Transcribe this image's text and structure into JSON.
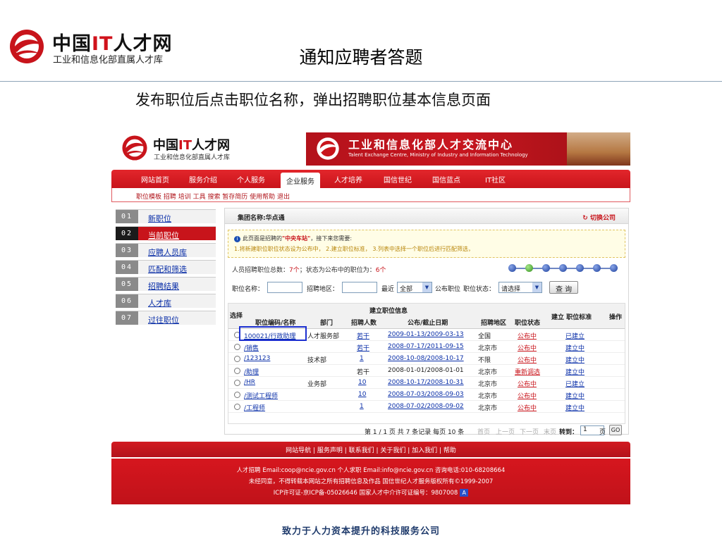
{
  "slide": {
    "brand_a": "中国",
    "brand_it": "IT",
    "brand_b": "人才网",
    "brand_sub": "工业和信息化部直属人才库",
    "title": "通知应聘者答题",
    "subtitle": "发布职位后点击职位名称，弹出招聘职位基本信息页面",
    "footer": "致力于人力资本提升的科技服务公司"
  },
  "site": {
    "brand_a": "中国",
    "brand_it": "IT",
    "brand_b": "人才网",
    "brand_sub": "工业和信息化部直属人才库",
    "banner_cn": "工业和信息化部人才交流中心",
    "banner_en": "Talent Exchange Centre,  Ministry of Industry and Information Technology"
  },
  "nav": [
    "网站首页",
    "服务介绍",
    "个人服务",
    "企业服务",
    "人才培养",
    "国信世纪",
    "国信蓝点",
    "IT社区"
  ],
  "nav_active": "企业服务",
  "subnav": "职位模板  招聘  培训  工具  搜索  暂存简历  使用帮助  退出",
  "sidebar": [
    {
      "num": "01",
      "label": "新职位"
    },
    {
      "num": "02",
      "label": "当前职位",
      "active": true
    },
    {
      "num": "03",
      "label": "应聘人员库"
    },
    {
      "num": "04",
      "label": "匹配和筛选"
    },
    {
      "num": "05",
      "label": "招聘结果"
    },
    {
      "num": "06",
      "label": "人才库"
    },
    {
      "num": "07",
      "label": "过往职位"
    }
  ],
  "panel": {
    "group": "集团名称:华点通",
    "switch": "切换公司",
    "notice_pre": "此页面是招聘的",
    "notice_site": "\"中央车站\"",
    "notice_post": "，接下来您需要:",
    "notice_line2": "1.将新建职位职位状态设为公布中， 2.建立职位标准， 3.列表中选择一个职位后进行匹配筛选，",
    "stats_a": "人员招聘职位总数：",
    "stats_total": "7个",
    "stats_b": "；状态为公布中的职位为：",
    "stats_pub": "6个"
  },
  "filter": {
    "name_label": "职位名称：",
    "region_label": "招聘地区：",
    "recent_label": "最近",
    "recent_value": "全部",
    "publish_label": "公布职位",
    "status_label": "职位状态：",
    "status_value": "请选择",
    "search_button": "查 询"
  },
  "table": {
    "headers": {
      "select": "选择",
      "group": "建立职位信息",
      "code": "职位编码/名称",
      "dept": "部门",
      "count": "招聘人数",
      "date": "公布/截止日期",
      "region": "招聘地区",
      "status": "职位状态",
      "standard": "建立 职位标准",
      "op": "操作"
    },
    "rows": [
      {
        "code": "100021/行政助理",
        "dept": "人才服务部",
        "count": "若干",
        "date": "2009-01-13/2009-03-13",
        "region": "全国",
        "status": "公布中",
        "standard": "已建立"
      },
      {
        "code": "/销售",
        "dept": "",
        "count": "若干",
        "date": "2008-07-17/2011-09-15",
        "region": "北京市",
        "status": "公布中",
        "standard": "建立中"
      },
      {
        "code": "/123123",
        "dept": "技术部",
        "count": "1",
        "date": "2008-10-08/2008-10-17",
        "region": "不限",
        "status": "公布中",
        "standard": "建立中"
      },
      {
        "code": "/助理",
        "dept": "",
        "count": "若干",
        "date": "2008-01-01/2008-01-01",
        "region": "北京市",
        "status": "重新调选",
        "standard": "建立中"
      },
      {
        "code": "/HR",
        "dept": "业务部",
        "count": "10",
        "date": "2008-10-17/2008-10-31",
        "region": "北京市",
        "status": "公布中",
        "standard": "已建立"
      },
      {
        "code": "/测试工程师",
        "dept": "",
        "count": "10",
        "date": "2008-07-03/2008-09-03",
        "region": "北京市",
        "status": "公布中",
        "standard": "建立中"
      },
      {
        "code": "/工程师",
        "dept": "",
        "count": "1",
        "date": "2008-07-02/2008-09-02",
        "region": "北京市",
        "status": "公布中",
        "standard": "建立中"
      }
    ]
  },
  "pager": {
    "summary": "第 1 / 1 页 共 7 条记录 每页 10 条",
    "first": "首页",
    "prev": "上一页",
    "next": "下一页",
    "last": "末页",
    "goto_label": "转到：",
    "goto_value": "1",
    "page_unit": "页",
    "go": "GO"
  },
  "footer": {
    "links": "网站导航 | 服务声明 | 联系我们 | 关于我们 | 加入我们 | 帮助",
    "line1": "人才招聘 Email:coop@ncie.gov.cn    个人求职 Email:info@ncie.gov.cn    咨询电话:010-68208664",
    "line2": "未经同意，不得转载本网站之所有招聘信息及作品 国信世纪人才服务版权所有©1999-2007",
    "line3": "ICP许可证-京ICP备-05026646 国家人才中介许可证编号：9807008"
  },
  "colors": {
    "brand_red": "#c8141b",
    "link_blue": "#0a2fa8",
    "highlight": "#1c2fd0"
  }
}
